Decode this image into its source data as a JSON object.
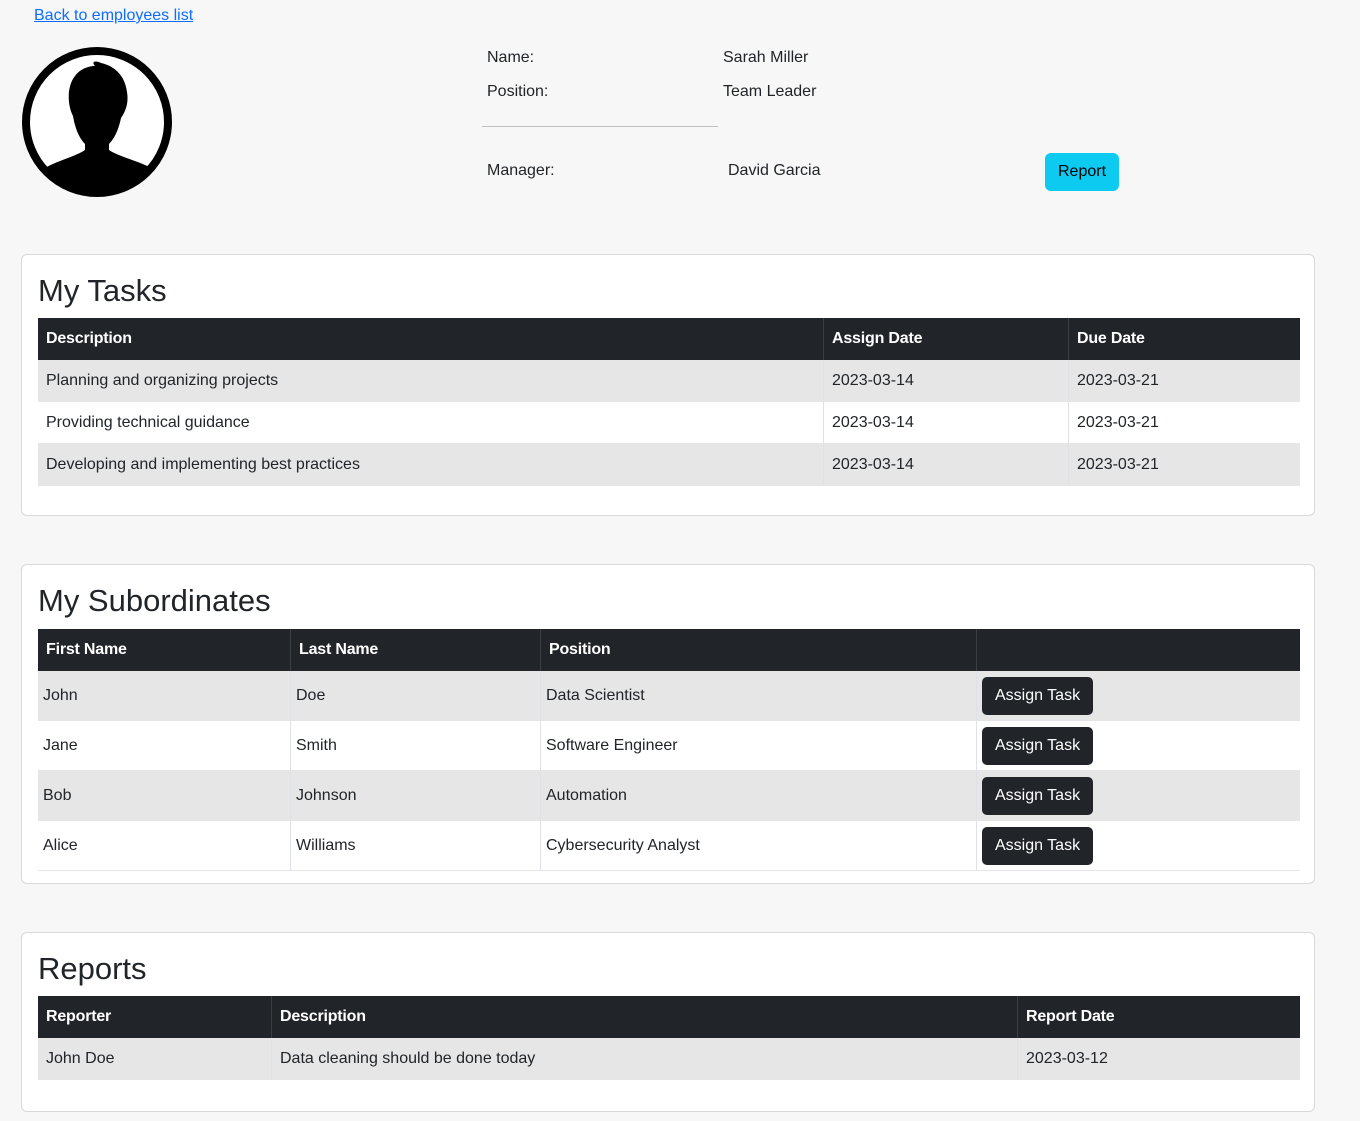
{
  "nav": {
    "back_link": "Back to employees list"
  },
  "profile": {
    "name_label": "Name:",
    "name_value": "Sarah Miller",
    "position_label": "Position:",
    "position_value": "Team Leader",
    "manager_label": "Manager:",
    "manager_value": "David Garcia",
    "report_button": "Report",
    "avatar_icon": "user-avatar-icon"
  },
  "tasks": {
    "title": "My Tasks",
    "headers": [
      "Description",
      "Assign Date",
      "Due Date"
    ],
    "rows": [
      [
        "Planning and organizing projects",
        "2023-03-14",
        "2023-03-21"
      ],
      [
        "Providing technical guidance",
        "2023-03-14",
        "2023-03-21"
      ],
      [
        "Developing and implementing best practices",
        "2023-03-14",
        "2023-03-21"
      ]
    ]
  },
  "subordinates": {
    "title": "My Subordinates",
    "headers": [
      "First Name",
      "Last Name",
      "Position",
      ""
    ],
    "action_label": "Assign Task",
    "rows": [
      [
        "John",
        "Doe",
        "Data Scientist"
      ],
      [
        "Jane",
        "Smith",
        "Software Engineer"
      ],
      [
        "Bob",
        "Johnson",
        "Automation"
      ],
      [
        "Alice",
        "Williams",
        "Cybersecurity Analyst"
      ]
    ]
  },
  "reports": {
    "title": "Reports",
    "headers": [
      "Reporter",
      "Description",
      "Report Date"
    ],
    "rows": [
      [
        "John Doe",
        "Data cleaning should be done today",
        "2023-03-12"
      ]
    ]
  },
  "colors": {
    "page_bg": "#f7f7f7",
    "table_header_bg": "#212529",
    "report_button_bg": "#0dcaf0",
    "link": "#0d6efd"
  }
}
